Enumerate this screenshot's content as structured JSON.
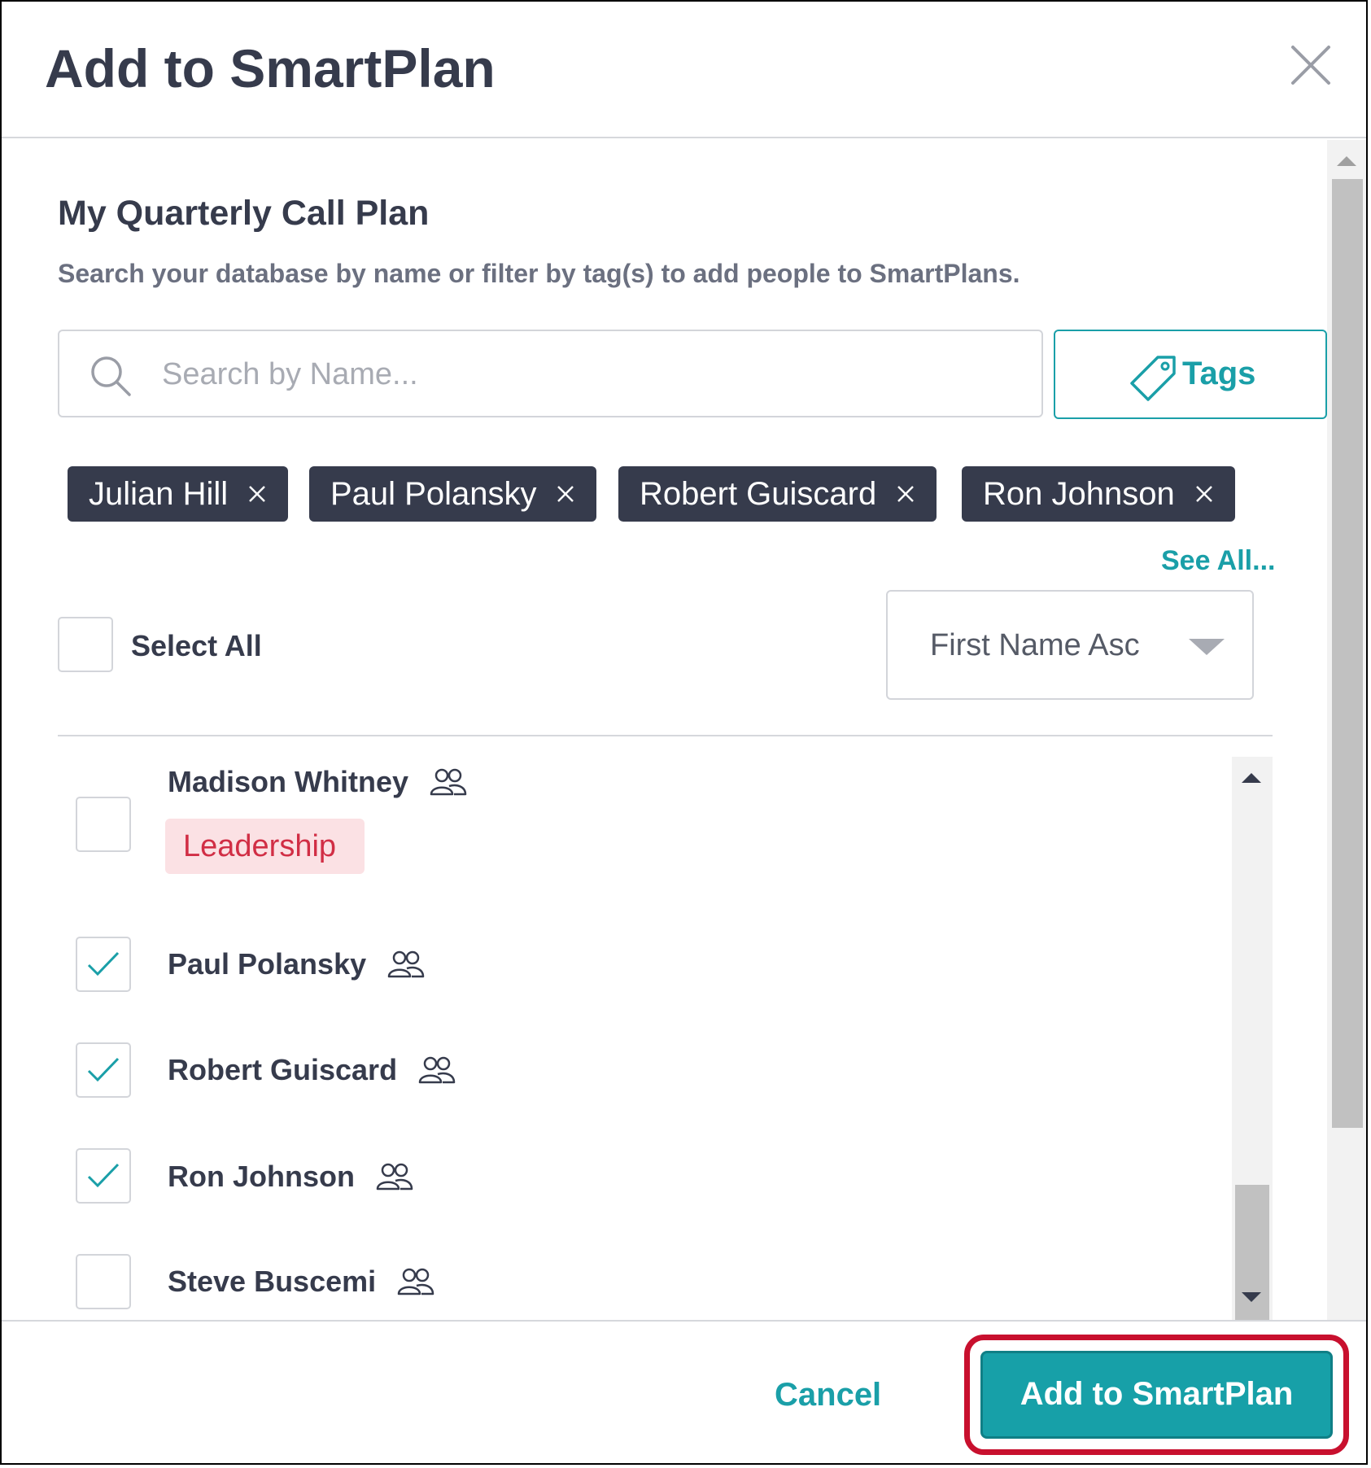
{
  "dialog": {
    "title": "Add to SmartPlan"
  },
  "plan": {
    "name": "My Quarterly Call Plan",
    "description": "Search your database by name or filter by tag(s) to add people to SmartPlans."
  },
  "search": {
    "placeholder": "Search by Name...",
    "value": ""
  },
  "tags_button": {
    "label": "Tags"
  },
  "selected_chips": [
    {
      "label": "Julian Hill"
    },
    {
      "label": "Paul Polansky"
    },
    {
      "label": "Robert Guiscard"
    },
    {
      "label": "Ron Johnson"
    }
  ],
  "see_all": "See All...",
  "select_all": {
    "label": "Select All",
    "checked": false
  },
  "sort": {
    "value": "First Name Asc"
  },
  "contacts": [
    {
      "name": "Madison Whitney",
      "checked": false,
      "tag": "Leadership"
    },
    {
      "name": "Paul Polansky",
      "checked": true
    },
    {
      "name": "Robert Guiscard",
      "checked": true
    },
    {
      "name": "Ron Johnson",
      "checked": true
    },
    {
      "name": "Steve Buscemi",
      "checked": false
    }
  ],
  "footer": {
    "cancel_label": "Cancel",
    "submit_label": "Add to SmartPlan"
  },
  "colors": {
    "accent": "#1a9fa8",
    "chip_bg": "#363b4c",
    "tag_bg": "#fbe1e4",
    "tag_text": "#d12e45",
    "highlight": "#c8102e"
  },
  "icons": {
    "close": "close-icon",
    "search": "search-icon",
    "tag": "tag-icon",
    "chip_remove": "close-icon",
    "contact_type": "people-icon",
    "check": "checkmark-icon",
    "sort": "chevron-down-icon"
  }
}
